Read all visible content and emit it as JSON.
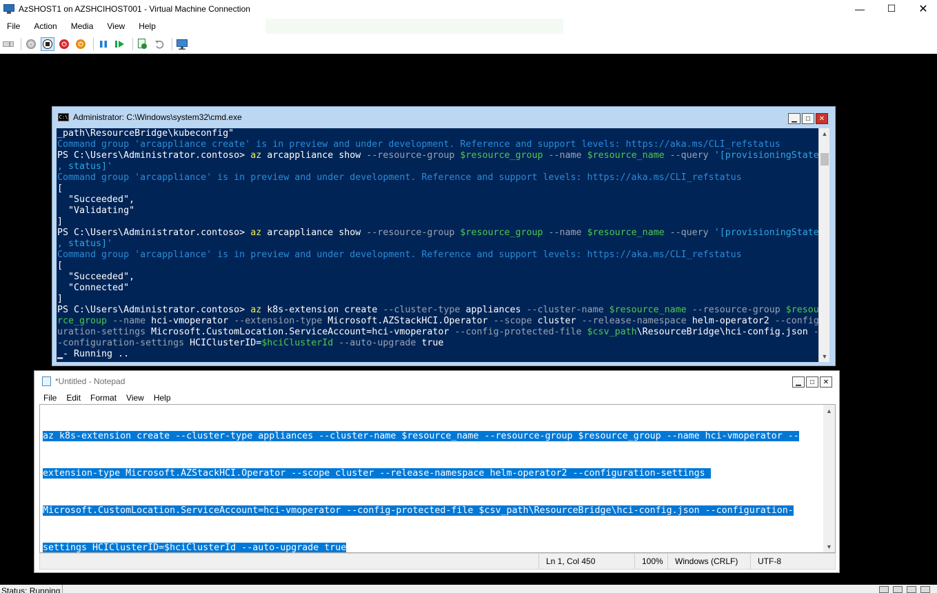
{
  "host": {
    "title": "AzSHOST1 on AZSHCIHOST001 - Virtual Machine Connection",
    "window_controls": {
      "minimize": "—",
      "maximize": "☐",
      "close": "✕"
    },
    "menu": [
      "File",
      "Action",
      "Media",
      "View",
      "Help"
    ],
    "toolbar": [
      {
        "name": "ctrl-alt-del",
        "icon": "keyboard-icon"
      },
      {
        "name": "start",
        "icon": "start-icon"
      },
      {
        "name": "turn-off",
        "icon": "turn-off-icon"
      },
      {
        "name": "shut-down",
        "icon": "shut-down-icon"
      },
      {
        "name": "save",
        "icon": "save-icon"
      },
      {
        "name": "pause",
        "icon": "pause-icon"
      },
      {
        "name": "resume",
        "icon": "resume-icon"
      },
      {
        "name": "checkpoint",
        "icon": "checkpoint-icon"
      },
      {
        "name": "revert",
        "icon": "revert-icon"
      },
      {
        "name": "enhanced-session",
        "icon": "enhanced-session-icon"
      }
    ],
    "status": "Status: Running"
  },
  "cmd": {
    "title": "Administrator: C:\\Windows\\system32\\cmd.exe",
    "lines": [
      [
        {
          "c": "wh",
          "t": "_path\\ResourceBridge\\kubeconfig\""
        }
      ],
      [
        {
          "c": "info",
          "t": "Command group 'arcappliance create' is in preview and under development. Reference and support levels: https://aka.ms/CLI_refstatus"
        }
      ],
      [
        {
          "c": "wh",
          "t": "PS C:\\Users\\Administrator.contoso> "
        },
        {
          "c": "cmd",
          "t": "az"
        },
        {
          "c": "wh",
          "t": " arcappliance show "
        },
        {
          "c": "param",
          "t": "--resource-group "
        },
        {
          "c": "var",
          "t": "$resource_group"
        },
        {
          "c": "param",
          "t": " --name "
        },
        {
          "c": "var",
          "t": "$resource_name"
        },
        {
          "c": "param",
          "t": " --query "
        },
        {
          "c": "str",
          "t": "'[provisioningState"
        }
      ],
      [
        {
          "c": "str",
          "t": ", status]'"
        }
      ],
      [
        {
          "c": "info",
          "t": "Command group 'arcappliance' is in preview and under development. Reference and support levels: https://aka.ms/CLI_refstatus"
        }
      ],
      [
        {
          "c": "wh",
          "t": "["
        }
      ],
      [
        {
          "c": "wh",
          "t": "  \"Succeeded\","
        }
      ],
      [
        {
          "c": "wh",
          "t": "  \"Validating\""
        }
      ],
      [
        {
          "c": "wh",
          "t": "]"
        }
      ],
      [
        {
          "c": "wh",
          "t": "PS C:\\Users\\Administrator.contoso> "
        },
        {
          "c": "cmd",
          "t": "az"
        },
        {
          "c": "wh",
          "t": " arcappliance show "
        },
        {
          "c": "param",
          "t": "--resource-group "
        },
        {
          "c": "var",
          "t": "$resource_group"
        },
        {
          "c": "param",
          "t": " --name "
        },
        {
          "c": "var",
          "t": "$resource_name"
        },
        {
          "c": "param",
          "t": " --query "
        },
        {
          "c": "str",
          "t": "'[provisioningState"
        }
      ],
      [
        {
          "c": "str",
          "t": ", status]'"
        }
      ],
      [
        {
          "c": "info",
          "t": "Command group 'arcappliance' is in preview and under development. Reference and support levels: https://aka.ms/CLI_refstatus"
        }
      ],
      [
        {
          "c": "wh",
          "t": "["
        }
      ],
      [
        {
          "c": "wh",
          "t": "  \"Succeeded\","
        }
      ],
      [
        {
          "c": "wh",
          "t": "  \"Connected\""
        }
      ],
      [
        {
          "c": "wh",
          "t": "]"
        }
      ],
      [
        {
          "c": "wh",
          "t": "PS C:\\Users\\Administrator.contoso> "
        },
        {
          "c": "cmd",
          "t": "az"
        },
        {
          "c": "wh",
          "t": " k8s-extension create "
        },
        {
          "c": "param",
          "t": "--cluster-type"
        },
        {
          "c": "wh",
          "t": " appliances "
        },
        {
          "c": "param",
          "t": "--cluster-name "
        },
        {
          "c": "var",
          "t": "$resource_name"
        },
        {
          "c": "param",
          "t": " --resource-group "
        },
        {
          "c": "var",
          "t": "$resou"
        }
      ],
      [
        {
          "c": "var",
          "t": "rce_group"
        },
        {
          "c": "param",
          "t": " --name"
        },
        {
          "c": "wh",
          "t": " hci-vmoperator "
        },
        {
          "c": "param",
          "t": "--extension-type"
        },
        {
          "c": "wh",
          "t": " Microsoft.AZStackHCI.Operator "
        },
        {
          "c": "param",
          "t": "--scope"
        },
        {
          "c": "wh",
          "t": " cluster "
        },
        {
          "c": "param",
          "t": "--release-namespace"
        },
        {
          "c": "wh",
          "t": " helm-operator2 "
        },
        {
          "c": "param",
          "t": "--config"
        }
      ],
      [
        {
          "c": "param",
          "t": "uration-settings"
        },
        {
          "c": "wh",
          "t": " Microsoft.CustomLocation.ServiceAccount=hci-vmoperator "
        },
        {
          "c": "param",
          "t": "--config-protected-file "
        },
        {
          "c": "var",
          "t": "$csv_path"
        },
        {
          "c": "wh",
          "t": "\\ResourceBridge\\hci-config.json "
        },
        {
          "c": "param",
          "t": "-"
        }
      ],
      [
        {
          "c": "param",
          "t": "-configuration-settings"
        },
        {
          "c": "wh",
          "t": " HCIClusterID="
        },
        {
          "c": "var",
          "t": "$hciClusterId"
        },
        {
          "c": "param",
          "t": " --auto-upgrade"
        },
        {
          "c": "wh",
          "t": " true"
        }
      ],
      [
        {
          "c": "wh",
          "t": "▁- Running .."
        }
      ]
    ]
  },
  "notepad": {
    "title": "*Untitled - Notepad",
    "menu": [
      "File",
      "Edit",
      "Format",
      "View",
      "Help"
    ],
    "lines": [
      "az k8s-extension create --cluster-type appliances --cluster-name $resource_name --resource-group $resource_group --name hci-vmoperator --",
      "extension-type Microsoft.AZStackHCI.Operator --scope cluster --release-namespace helm-operator2 --configuration-settings ",
      "Microsoft.CustomLocation.ServiceAccount=hci-vmoperator --config-protected-file $csv_path\\ResourceBridge\\hci-config.json --configuration-",
      "settings HCIClusterID=$hciClusterId --auto-upgrade true"
    ],
    "status": {
      "position": "Ln 1, Col 450",
      "zoom": "100%",
      "line_ending": "Windows (CRLF)",
      "encoding": "UTF-8"
    }
  },
  "colors": {
    "console_bg": "#012456",
    "console_info": "#2a8bd8",
    "console_cmd": "#f2f25b",
    "console_param": "#9aa3b3",
    "console_var": "#4ec94e",
    "selection": "#0078d7"
  }
}
